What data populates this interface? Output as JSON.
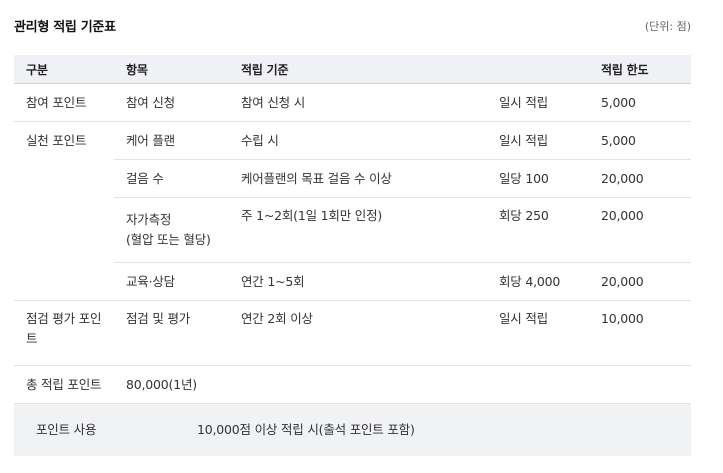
{
  "header": {
    "title": "관리형 적립 기준표",
    "unit": "(단위: 점)"
  },
  "table": {
    "columns": [
      "구분",
      "항목",
      "적립 기준",
      "",
      "적립 한도"
    ],
    "rows": [
      {
        "category": "참여 포인트",
        "item": "참여 신청",
        "criteria": "참여 신청 시",
        "rate": "일시 적립",
        "limit": "5,000"
      },
      {
        "category": "실천 포인트",
        "subrows": [
          {
            "item": "케어 플랜",
            "criteria": "수립 시",
            "rate": "일시 적립",
            "limit": "5,000"
          },
          {
            "item": "걸음 수",
            "criteria": "케어플랜의 목표 걸음 수 이상",
            "rate": "일당 100",
            "limit": "20,000"
          },
          {
            "item_line1": "자가측정",
            "item_line2": "(혈압 또는 혈당)",
            "criteria": "주 1~2회(1일 1회만 인정)",
            "rate": "회당 250",
            "limit": "20,000"
          },
          {
            "item": "교육·상담",
            "criteria": "연간 1~5회",
            "rate": "회당 4,000",
            "limit": "20,000"
          }
        ]
      },
      {
        "category_line1": "점검 평가 포인",
        "category_line2": "트",
        "item": "점검 및 평가",
        "criteria": "연간 2회 이상",
        "rate": "일시 적립",
        "limit": "10,000"
      },
      {
        "category": "총 적립 포인트",
        "value": "80,000(1년)"
      }
    ],
    "usage": {
      "label": "포인트 사용",
      "value": "10,000점 이상 적립 시(출석 포인트 포함)"
    }
  }
}
